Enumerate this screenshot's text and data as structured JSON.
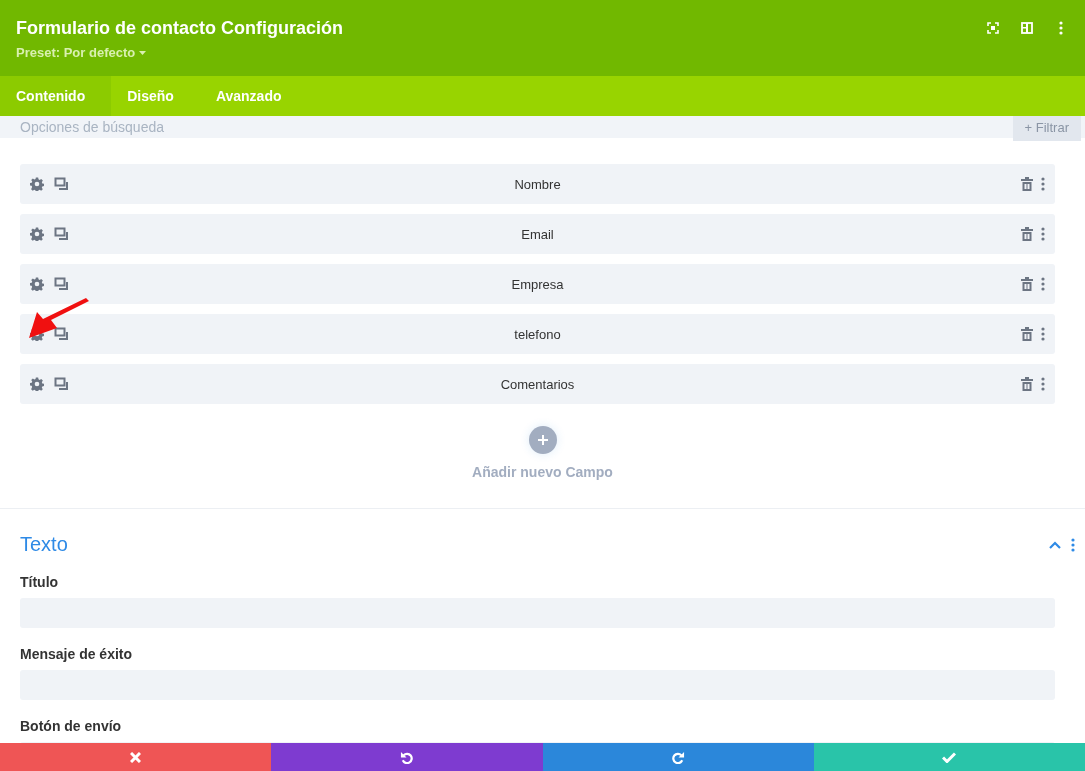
{
  "header": {
    "title": "Formulario de contacto Configuración",
    "preset": "Preset: Por defecto"
  },
  "tabs": [
    {
      "label": "Contenido",
      "selected": true
    },
    {
      "label": "Diseño",
      "selected": false
    },
    {
      "label": "Avanzado",
      "selected": false
    }
  ],
  "search": {
    "placeholder": "Opciones de búsqueda",
    "filter_button": "+ Filtrar"
  },
  "fields": [
    {
      "label": "Nombre"
    },
    {
      "label": "Email"
    },
    {
      "label": "Empresa"
    },
    {
      "label": "telefono"
    },
    {
      "label": "Comentarios"
    }
  ],
  "add_field": {
    "label": "Añadir nuevo Campo"
  },
  "section": {
    "title": "Texto",
    "expanded": true,
    "inputs": [
      {
        "label": "Título"
      },
      {
        "label": "Mensaje de éxito"
      },
      {
        "label": "Botón de envío"
      }
    ]
  },
  "footer": [
    {
      "kind": "cancel"
    },
    {
      "kind": "undo"
    },
    {
      "kind": "redo"
    },
    {
      "kind": "save"
    }
  ]
}
